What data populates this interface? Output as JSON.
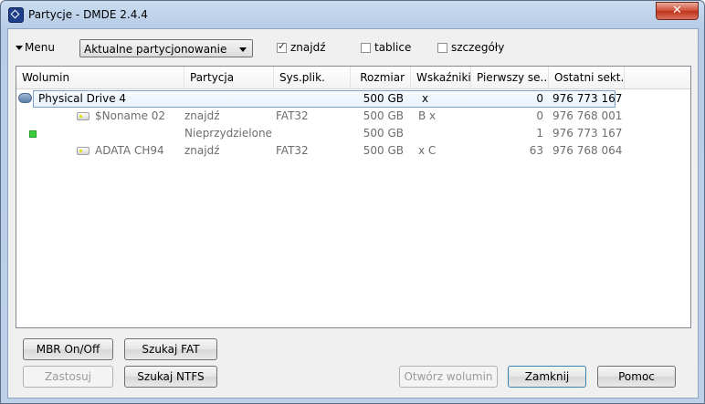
{
  "window": {
    "title": "Partycje - DMDE 2.4.4",
    "close_glyph": "✕"
  },
  "toolbar": {
    "menu_label": "Menu",
    "mode_select": "Aktualne partycjonowanie",
    "checkboxes": [
      {
        "label": "znajdź",
        "checked": true,
        "mark": "✓"
      },
      {
        "label": "tablice",
        "checked": false,
        "mark": ""
      },
      {
        "label": "szczegóły",
        "checked": false,
        "mark": ""
      }
    ]
  },
  "table": {
    "columns": [
      "Wolumin",
      "Partycja",
      "Sys.plik.",
      "Rozmiar",
      "Wskaźniki",
      "Pierwszy se...",
      "Ostatni sekt..."
    ],
    "rows": [
      {
        "wolumin": "Physical Drive 4",
        "partycja": "",
        "fs": "",
        "rozmiar": "500 GB",
        "wskazniki": "x",
        "pierwszy": "0",
        "ostatni": "976 773 167"
      },
      {
        "wolumin": "$Noname 02",
        "partycja": "znajdź",
        "fs": "FAT32",
        "rozmiar": "500 GB",
        "wskazniki": "B x",
        "pierwszy": "0",
        "ostatni": "976 768 001"
      },
      {
        "wolumin": "",
        "partycja": "Nieprzydzielone",
        "fs": "",
        "rozmiar": "500 GB",
        "wskazniki": "",
        "pierwszy": "1",
        "ostatni": "976 773 167"
      },
      {
        "wolumin": "ADATA CH94",
        "partycja": "znajdź",
        "fs": "FAT32",
        "rozmiar": "500 GB",
        "wskazniki": "x C",
        "pierwszy": "63",
        "ostatni": "976 768 064"
      }
    ]
  },
  "buttons": {
    "mbr": "MBR On/Off",
    "szukaj_fat": "Szukaj FAT",
    "zastosuj": "Zastosuj",
    "szukaj_ntfs": "Szukaj NTFS",
    "otworz": "Otwórz wolumin",
    "zamknij": "Zamknij",
    "pomoc": "Pomoc"
  }
}
